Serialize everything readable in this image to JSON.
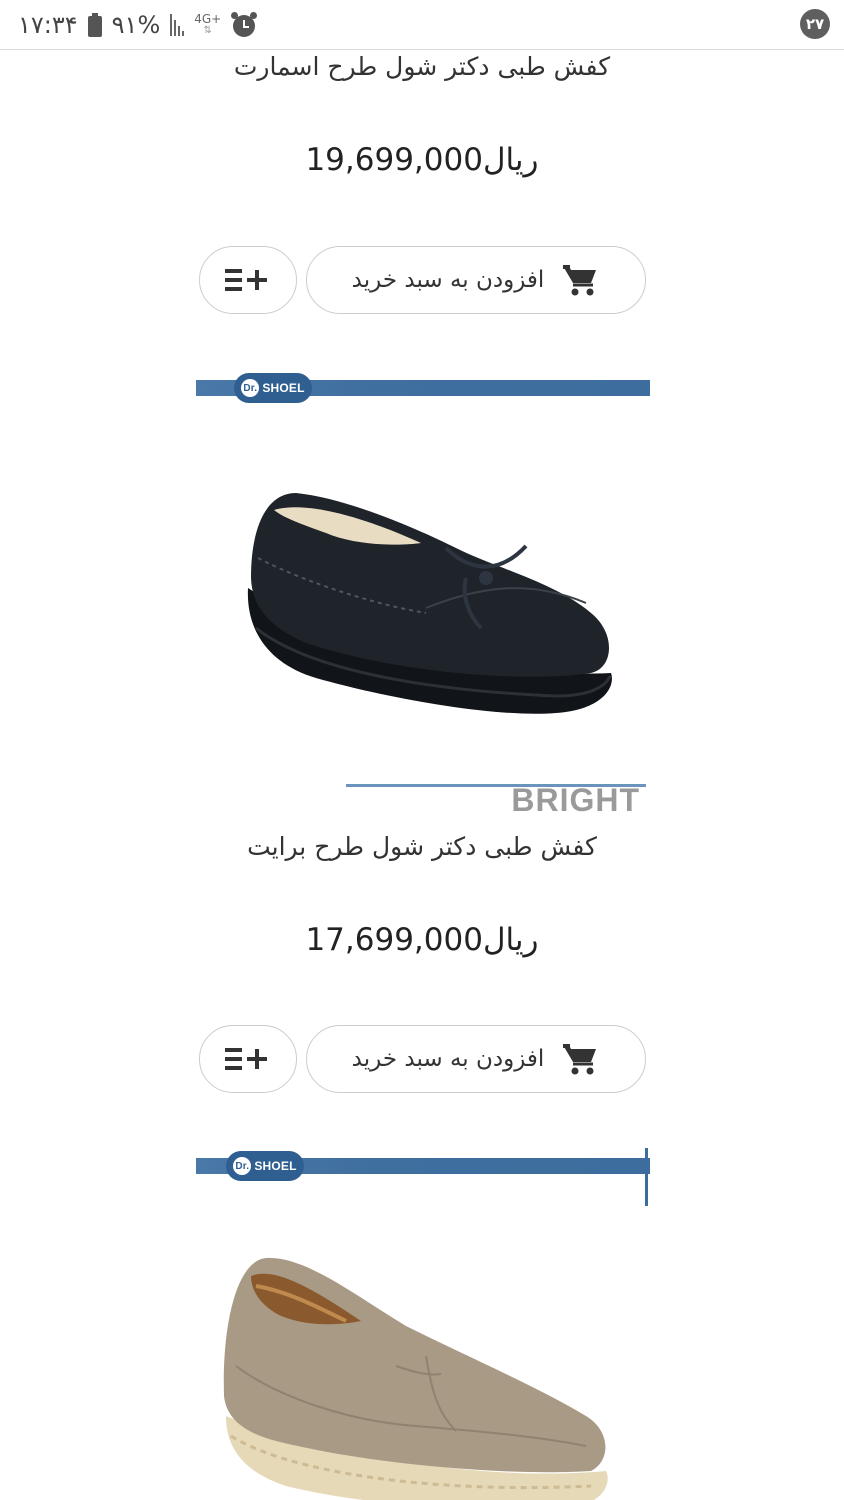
{
  "status_bar": {
    "time": "۱۷:۳۴",
    "battery": "۹۱%",
    "network": "4G+",
    "notification_count": "۲۷"
  },
  "products": [
    {
      "title": "کفش طبی دکتر شول طرح اسمارت",
      "price": "19,699,000ریال",
      "add_to_cart_label": "افزودن به سبد خرید",
      "compare_label": "≡+"
    },
    {
      "title": "کفش طبی دکتر شول طرح برایت",
      "price": "17,699,000ریال",
      "add_to_cart_label": "افزودن به سبد خرید",
      "compare_label": "≡+",
      "image": {
        "brand": "SHOEL",
        "brand_prefix": "Dr.",
        "model": "BRIGHT",
        "shoe_color": "#1f242b"
      }
    },
    {
      "image": {
        "brand": "SHOEL",
        "brand_prefix": "Dr.",
        "shoe_color": "#a99a85"
      }
    }
  ],
  "colors": {
    "brand_blue": "#3c6d9e",
    "button_border": "#cccccc",
    "text": "#333333"
  }
}
